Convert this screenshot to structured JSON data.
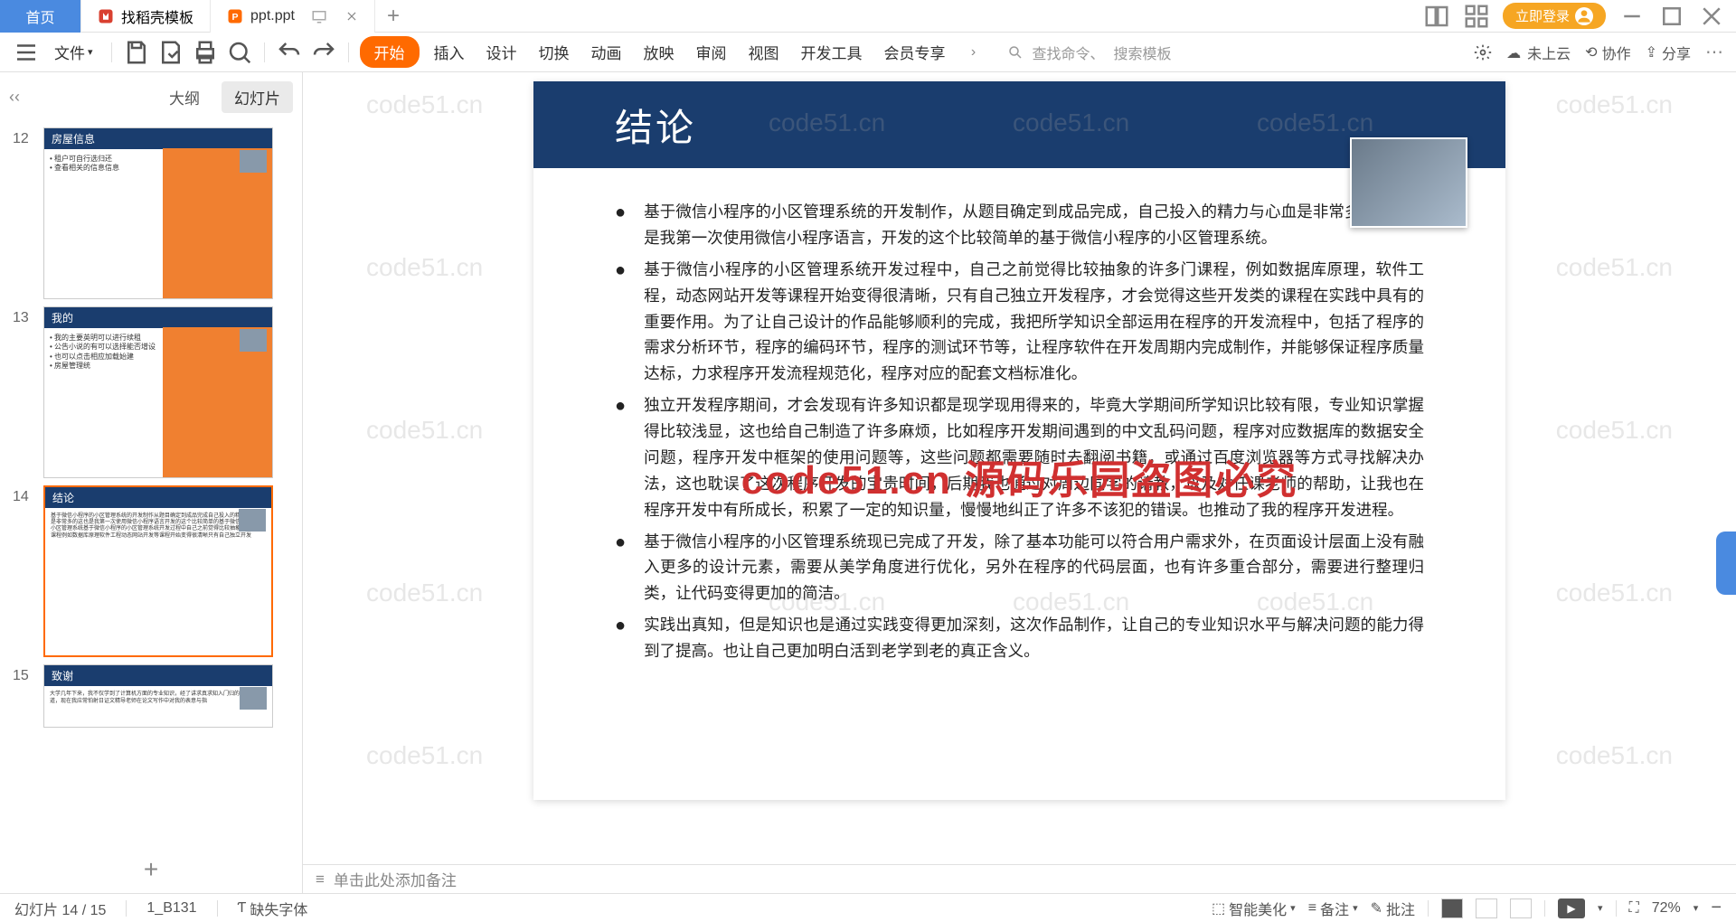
{
  "titlebar": {
    "home": "首页",
    "tab1": "找稻壳模板",
    "tab2": "ppt.ppt",
    "login": "立即登录"
  },
  "menubar": {
    "file": "文件",
    "start": "开始",
    "insert": "插入",
    "design": "设计",
    "transition": "切换",
    "animation": "动画",
    "slideshow": "放映",
    "review": "审阅",
    "view": "视图",
    "devtools": "开发工具",
    "vip": "会员专享",
    "search_cmd": "查找命令、",
    "search_tpl": "搜索模板",
    "cloud": "未上云",
    "collab": "协作",
    "share": "分享"
  },
  "sidebar": {
    "outline": "大纲",
    "slides": "幻灯片",
    "thumbs": [
      {
        "num": "12",
        "title": "房屋信息"
      },
      {
        "num": "13",
        "title": "我的"
      },
      {
        "num": "14",
        "title": "结论"
      },
      {
        "num": "15",
        "title": "致谢"
      }
    ]
  },
  "slide": {
    "title": "结论",
    "bullets": [
      "基于微信小程序的小区管理系统的开发制作，从题目确定到成品完成，自己投入的精力与心血是非常多的。这也是我第一次使用微信小程序语言，开发的这个比较简单的基于微信小程序的小区管理系统。",
      "基于微信小程序的小区管理系统开发过程中，自己之前觉得比较抽象的许多门课程，例如数据库原理，软件工程，动态网站开发等课程开始变得很清晰，只有自己独立开发程序，才会觉得这些开发类的课程在实践中具有的重要作用。为了让自己设计的作品能够顺利的完成，我把所学知识全部运用在程序的开发流程中，包括了程序的需求分析环节，程序的编码环节，程序的测试环节等，让程序软件在开发周期内完成制作，并能够保证程序质量达标，力求程序开发流程规范化，程序对应的配套文档标准化。",
      "独立开发程序期间，才会发现有许多知识都是现学现用得来的，毕竟大学期间所学知识比较有限，专业知识掌握得比较浅显，这也给自己制造了许多麻烦，比如程序开发期间遇到的中文乱码问题，程序对应数据库的数据安全问题，程序开发中框架的使用问题等，这些问题都需要随时去翻阅书籍，或通过百度浏览器等方式寻找解决办法，这也耽误了这次程序开发的宝贵时间，后期我也通过对周边同学的请教，以及对任课老师的帮助，让我也在程序开发中有所成长，积累了一定的知识量，慢慢地纠正了许多不该犯的错误。也推动了我的程序开发进程。",
      "基于微信小程序的小区管理系统现已完成了开发，除了基本功能可以符合用户需求外，在页面设计层面上没有融入更多的设计元素，需要从美学角度进行优化，另外在程序的代码层面，也有许多重合部分，需要进行整理归类，让代码变得更加的简洁。",
      "实践出真知，但是知识也是通过实践变得更加深刻，这次作品制作，让自己的专业知识水平与解决问题的能力得到了提高。也让自己更加明白活到老学到老的真正含义。"
    ],
    "watermark_main": "code51.cn  源码乐园盗图必究",
    "watermark_bg": "code51.cn"
  },
  "notes": {
    "placeholder": "单击此处添加备注"
  },
  "status": {
    "slide_info": "幻灯片 14 / 15",
    "code": "1_B131",
    "missing_fonts": "缺失字体",
    "beautify": "智能美化",
    "notes": "备注",
    "comments": "批注",
    "zoom": "72%"
  }
}
